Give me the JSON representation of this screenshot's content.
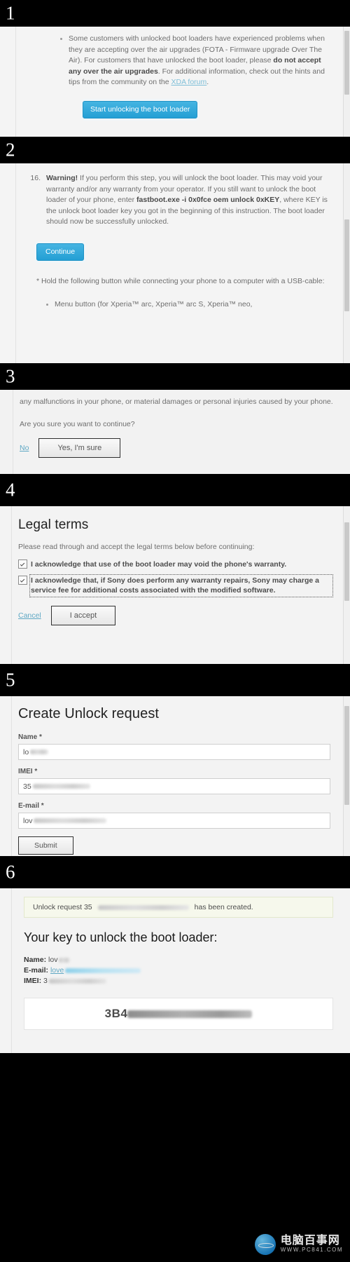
{
  "meta": {
    "title": "Sony Xperia boot loader unlock walkthrough",
    "accent_blue": "#34a9dc",
    "link_blue": "#7fbfd8",
    "band_black": "#000000",
    "page_bg": "#f4f4f4"
  },
  "panels": [
    {
      "number": "1",
      "bullet": {
        "pre_bold": "Some customers with unlocked boot loaders have experienced problems when they are accepting over the air upgrades (FOTA - Firmware upgrade Over The Air). For customers that have unlocked the boot loader, please ",
        "bold": "do not accept any over the air upgrades",
        "post_bold": ". For additional information, check out the hints and tips from the community on the ",
        "link": "XDA forum",
        "tail": "."
      },
      "button": "Start unlocking the boot loader"
    },
    {
      "number": "2",
      "item_number": "16.",
      "warning_label": "Warning!",
      "warning_pre": " If you perform this step, you will unlock the boot loader. This may void your warranty and/or any warranty from your operator. If you still want to unlock the boot loader of your phone, enter ",
      "command": "fastboot.exe -i 0x0fce oem unlock 0xKEY",
      "warning_post": ", where KEY is the unlock boot loader key you got in the beginning of this instruction. The boot loader should now be successfully unlocked.",
      "button": "Continue",
      "footnote": "* Hold the following button while connecting your phone to a computer with a USB-cable:",
      "sub_bullet": "Menu button (for Xperia™ arc, Xperia™ arc S, Xperia™ neo,"
    },
    {
      "number": "3",
      "paragraph": "any malfunctions in your phone, or material damages or personal injuries caused by your phone.",
      "question": "Are you sure you want to continue?",
      "cancel_link": "No",
      "confirm_button": "Yes, I'm sure"
    },
    {
      "number": "4",
      "heading": "Legal terms",
      "lead": "Please read through and accept the legal terms below before continuing:",
      "terms": [
        "I acknowledge that use of the boot loader may void the phone's warranty.",
        "I acknowledge that, if Sony does perform any warranty repairs, Sony may charge a service fee for additional costs associated with the modified software."
      ],
      "cancel_link": "Cancel",
      "accept_button": "I accept"
    },
    {
      "number": "5",
      "heading": "Create Unlock request",
      "fields": [
        {
          "label": "Name *",
          "value": "lo"
        },
        {
          "label": "IMEI *",
          "value": "35"
        },
        {
          "label": "E-mail *",
          "value": "lov"
        }
      ],
      "submit_button": "Submit"
    },
    {
      "number": "6",
      "notice_pre": "Unlock request 35",
      "notice_post": "has been created.",
      "heading": "Your key to unlock the boot loader:",
      "kv": [
        {
          "label": "Name:",
          "value": "lov"
        },
        {
          "label": "E-mail:",
          "value": "love"
        },
        {
          "label": "IMEI:",
          "value": "3"
        }
      ],
      "key_prefix": "3B4"
    }
  ],
  "watermark": {
    "name": "电脑百事网",
    "url": "WWW.PC841.COM",
    "icon": "globe-icon"
  }
}
